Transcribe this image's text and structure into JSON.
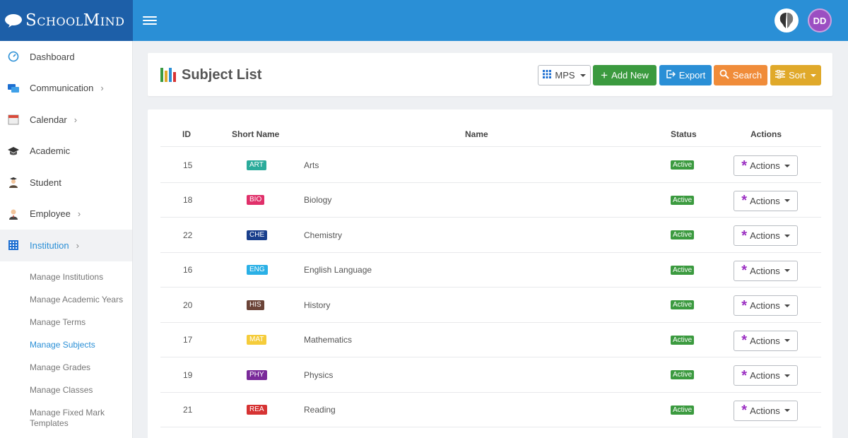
{
  "app": {
    "brand": "SchoolMind"
  },
  "user": {
    "initials": "DD"
  },
  "sidebar": {
    "items": [
      {
        "label": "Dashboard",
        "icon": "dashboard-icon",
        "chevron": false
      },
      {
        "label": "Communication",
        "icon": "chat-icon",
        "chevron": true
      },
      {
        "label": "Calendar",
        "icon": "calendar-icon",
        "chevron": true
      },
      {
        "label": "Academic",
        "icon": "graduation-cap-icon",
        "chevron": false
      },
      {
        "label": "Student",
        "icon": "student-icon",
        "chevron": false
      },
      {
        "label": "Employee",
        "icon": "employee-icon",
        "chevron": true
      },
      {
        "label": "Institution",
        "icon": "building-icon",
        "chevron": true,
        "active": true
      }
    ],
    "subitems": [
      {
        "label": "Manage Institutions"
      },
      {
        "label": "Manage Academic Years"
      },
      {
        "label": "Manage Terms"
      },
      {
        "label": "Manage Subjects",
        "active": true
      },
      {
        "label": "Manage Grades"
      },
      {
        "label": "Manage Classes"
      },
      {
        "label": "Manage Fixed Mark Templates"
      }
    ]
  },
  "header": {
    "title": "Subject List",
    "buttons": {
      "mps": "MPS",
      "add_new": "Add New",
      "export": "Export",
      "search": "Search",
      "sort": "Sort"
    }
  },
  "table": {
    "columns": {
      "id": "ID",
      "short_name": "Short Name",
      "name": "Name",
      "status": "Status",
      "actions": "Actions"
    },
    "rows": [
      {
        "id": "15",
        "short": "ART",
        "color": "#2bab9b",
        "name": "Arts",
        "status": "Active",
        "action": "Actions"
      },
      {
        "id": "18",
        "short": "BIO",
        "color": "#e0306a",
        "name": "Biology",
        "status": "Active",
        "action": "Actions"
      },
      {
        "id": "22",
        "short": "CHE",
        "color": "#1a3f8c",
        "name": "Chemistry",
        "status": "Active",
        "action": "Actions"
      },
      {
        "id": "16",
        "short": "ENG",
        "color": "#2ab0e6",
        "name": "English Language",
        "status": "Active",
        "action": "Actions"
      },
      {
        "id": "20",
        "short": "HIS",
        "color": "#6b4438",
        "name": "History",
        "status": "Active",
        "action": "Actions"
      },
      {
        "id": "17",
        "short": "MAT",
        "color": "#f5cc3a",
        "name": "Mathematics",
        "status": "Active",
        "action": "Actions"
      },
      {
        "id": "19",
        "short": "PHY",
        "color": "#7a2a9a",
        "name": "Physics",
        "status": "Active",
        "action": "Actions"
      },
      {
        "id": "21",
        "short": "REA",
        "color": "#d63333",
        "name": "Reading",
        "status": "Active",
        "action": "Actions"
      }
    ]
  },
  "colors": {
    "primary": "#2a8fd6",
    "brand_dark": "#1d5fa8",
    "success": "#3b9a3f",
    "warning": "#f08c3a",
    "sort": "#e0a92a"
  }
}
